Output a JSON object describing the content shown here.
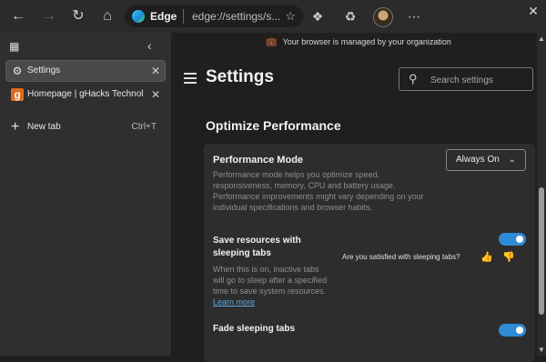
{
  "browser": {
    "edge_label": "Edge",
    "address_url": "edge://settings/s...",
    "new_tab_shortcut": "Ctrl+T"
  },
  "sidebar": {
    "tabs": [
      {
        "label": "Settings",
        "icon": "gear-icon"
      },
      {
        "label": "Homepage | gHacks Technology",
        "icon": "ghacks-favicon"
      }
    ],
    "new_tab_label": "New tab"
  },
  "settings": {
    "managed_banner": "Your browser is managed by your organization",
    "title": "Settings",
    "search_placeholder": "Search settings",
    "section_title": "Optimize Performance",
    "performance_mode": {
      "title": "Performance Mode",
      "description": "Performance mode helps you optimize speed, responsiveness, memory, CPU and battery usage. Performance improvements might vary depending on your individual specifications and browser habits.",
      "selected": "Always On"
    },
    "sleeping_tabs": {
      "title": "Save resources with sleeping tabs",
      "description": "When this is on, inactive tabs will go to sleep after a specified time to save system resources.",
      "learn_more": "Learn more",
      "feedback_question": "Are you satisfied with sleeping tabs?",
      "enabled": true
    },
    "fade_sleeping_tabs": {
      "title": "Fade sleeping tabs",
      "enabled": true
    }
  },
  "colors": {
    "accent": "#2f8bd6",
    "link": "#5aa9e6"
  }
}
